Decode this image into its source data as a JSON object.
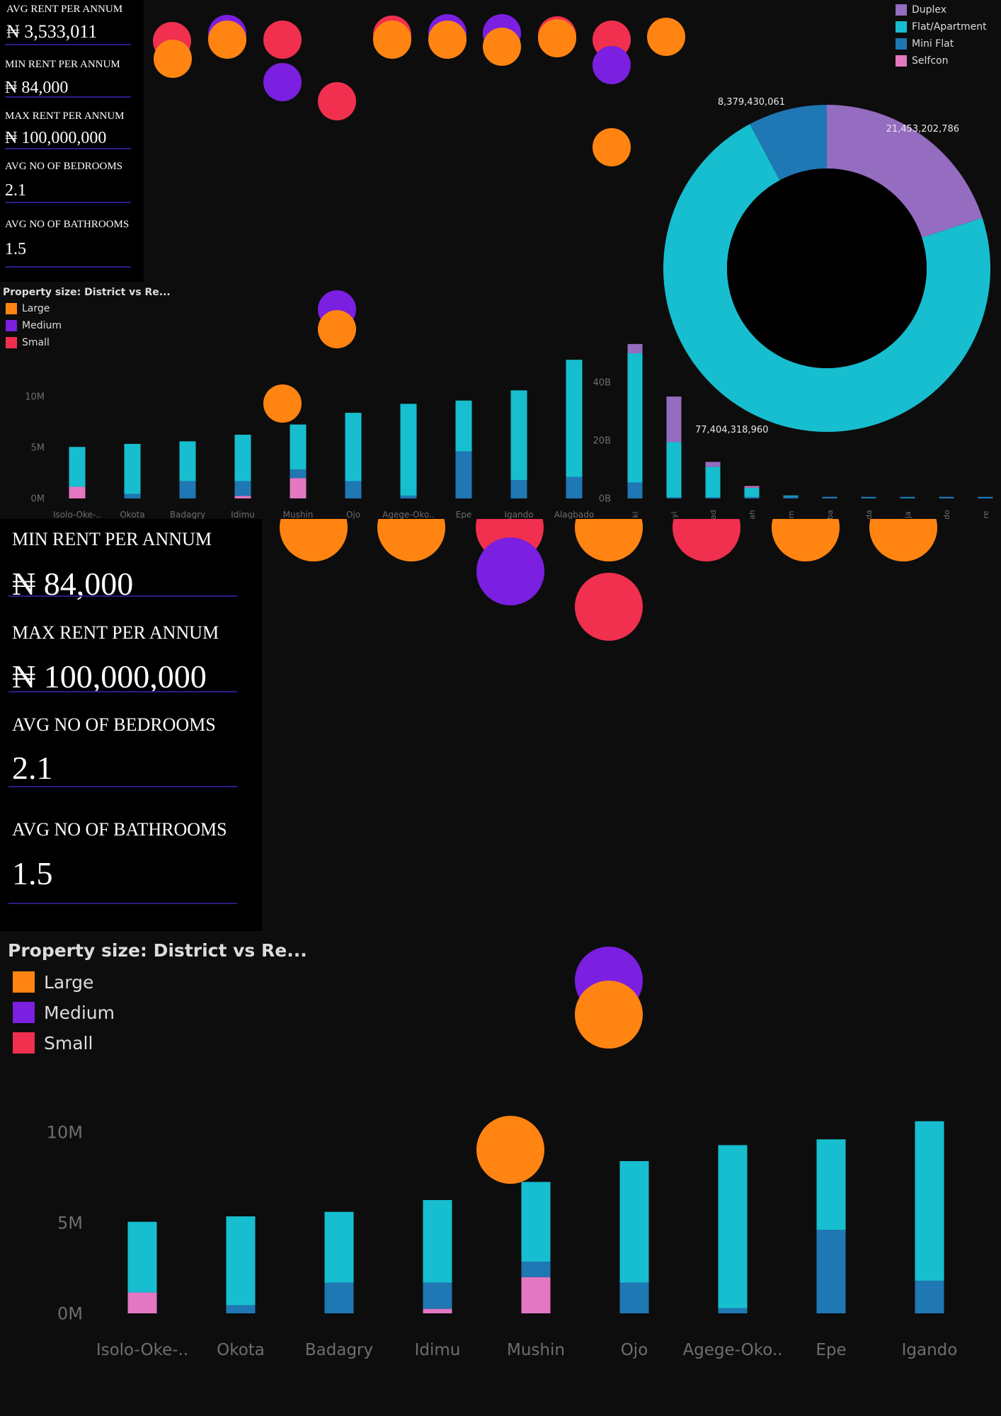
{
  "kpis": [
    {
      "title": "AVG RENT PER ANNUM",
      "value": "₦ 3,533,011"
    },
    {
      "title": "MIN RENT PER ANNUM",
      "value": "₦ 84,000"
    },
    {
      "title": "MAX RENT PER ANNUM",
      "value": "₦ 100,000,000"
    },
    {
      "title": "AVG NO OF BEDROOMS",
      "value": "2.1"
    },
    {
      "title": "AVG NO OF BATHROOMS",
      "value": "1.5"
    }
  ],
  "size_legend": {
    "title": "Property size: District vs Re...",
    "items": [
      {
        "label": "Large",
        "color": "#ff8412"
      },
      {
        "label": "Medium",
        "color": "#7b1fe0"
      },
      {
        "label": "Small",
        "color": "#f0304e"
      }
    ]
  },
  "type_legend": {
    "items": [
      {
        "label": "Duplex",
        "color": "#946cc0"
      },
      {
        "label": "Flat/Apartment",
        "color": "#17becf"
      },
      {
        "label": "Mini Flat",
        "color": "#1f77b4"
      },
      {
        "label": "Selfcon",
        "color": "#e377c2"
      }
    ]
  },
  "chart_data": [
    {
      "type": "pie",
      "categories": [
        "Duplex",
        "Flat/Apartment",
        "Mini Flat"
      ],
      "values": [
        21453202786,
        77404318960,
        8379430061
      ],
      "labels": [
        "21,453,202,786",
        "77,404,318,960",
        "8,379,430,061"
      ],
      "colors": [
        "#946cc0",
        "#17becf",
        "#1f77b4"
      ]
    },
    {
      "type": "bar",
      "stacked": true,
      "categories": [
        "Isolo-Oke-..",
        "Okota",
        "Badagry",
        "Idimu",
        "Mushin",
        "Ojo",
        "Agege-Oko..",
        "Epe",
        "Igando",
        "Alagbado"
      ],
      "tick_labels": [
        "0M",
        "5M",
        "10M"
      ],
      "ylim": [
        -2000000,
        12500000
      ],
      "series": [
        {
          "name": "Selfcon",
          "values": [
            1150000,
            0,
            0,
            250000,
            2000000,
            0,
            0,
            0,
            0,
            0
          ]
        },
        {
          "name": "Mini Flat",
          "values": [
            0,
            450000,
            1700000,
            1450000,
            850000,
            1700000,
            280000,
            4600000,
            1800000,
            2100000
          ]
        },
        {
          "name": "Flat/Apartment",
          "values": [
            3900000,
            4900000,
            3900000,
            4550000,
            4400000,
            6700000,
            9000000,
            5000000,
            8800000,
            11500000
          ]
        }
      ]
    },
    {
      "type": "bar",
      "stacked": true,
      "categories": [
        "Lekki",
        "Ikoyi",
        "Victoria Island",
        "Ajah",
        "Surulere",
        "Yaba",
        "Gbagada",
        "Ikeja",
        "Magodo",
        "Ikorodu",
        "Ilupeju"
      ],
      "tick_labels": [
        "0B",
        "20B",
        "40B"
      ],
      "ylim": [
        -4000000000,
        50000000000
      ],
      "series": [
        {
          "name": "Mini Flat",
          "values": [
            5500000000,
            400000000,
            400000000,
            500000000,
            700000000,
            550000000,
            550000000,
            550000000,
            550000000,
            550000000,
            550000000
          ]
        },
        {
          "name": "Flat/Apartment",
          "values": [
            44500000000,
            19000000000,
            10500000000,
            3200000000,
            300000000,
            0,
            0,
            0,
            0,
            0,
            0
          ]
        },
        {
          "name": "Duplex",
          "values": [
            3200000000,
            15700000000,
            1700000000,
            150000000,
            0,
            0,
            0,
            0,
            0,
            0,
            0
          ]
        },
        {
          "name": "Selfcon",
          "values": [
            0,
            0,
            0,
            400000000,
            0,
            0,
            0,
            0,
            0,
            0,
            0
          ]
        }
      ]
    }
  ]
}
